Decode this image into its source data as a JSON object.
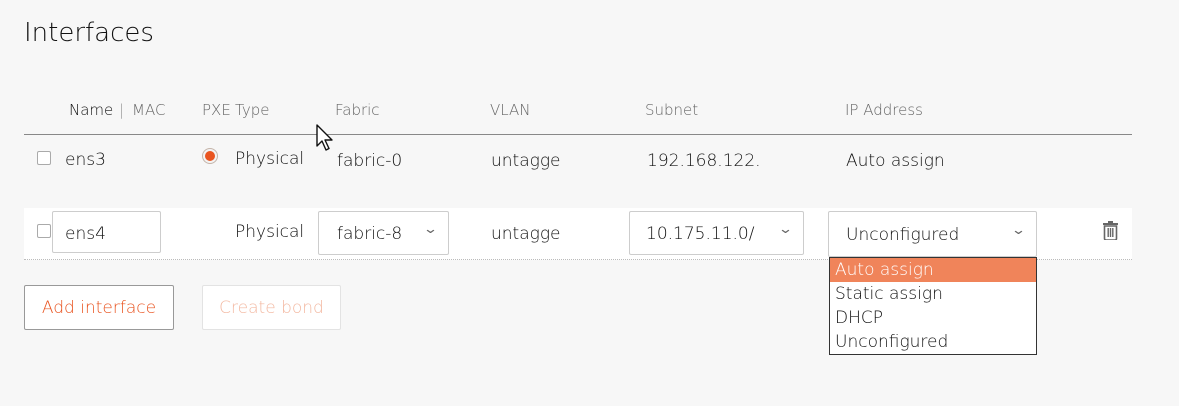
{
  "page": {
    "title": "Interfaces"
  },
  "table": {
    "headers": {
      "name": "Name",
      "separator": "|",
      "mac": "MAC",
      "pxe": "PXE",
      "type": "Type",
      "fabric": "Fabric",
      "vlan": "VLAN",
      "subnet": "Subnet",
      "ip_address": "IP Address"
    },
    "rows": [
      {
        "name": "ens3",
        "pxe": true,
        "type": "Physical",
        "fabric": "fabric-0",
        "vlan": "untagge",
        "subnet": "192.168.122.",
        "ip_address": "Auto assign"
      },
      {
        "name": "ens4",
        "pxe": false,
        "type": "Physical",
        "fabric": "fabric-8",
        "vlan": "untagge",
        "subnet": "10.175.11.0/",
        "ip_address": "Unconfigured"
      }
    ]
  },
  "ip_dropdown": {
    "options": [
      "Auto assign",
      "Static assign",
      "DHCP",
      "Unconfigured"
    ],
    "highlighted": "Auto assign"
  },
  "buttons": {
    "add_interface": "Add interface",
    "create_bond": "Create bond"
  },
  "icons": {
    "chevron": "chevron-down-icon",
    "delete": "trash-icon",
    "pxe": "radio-selected-icon"
  },
  "colors": {
    "accent": "#e95420",
    "highlight": "#f0845a",
    "disabled_text": "#f3b9a2"
  }
}
